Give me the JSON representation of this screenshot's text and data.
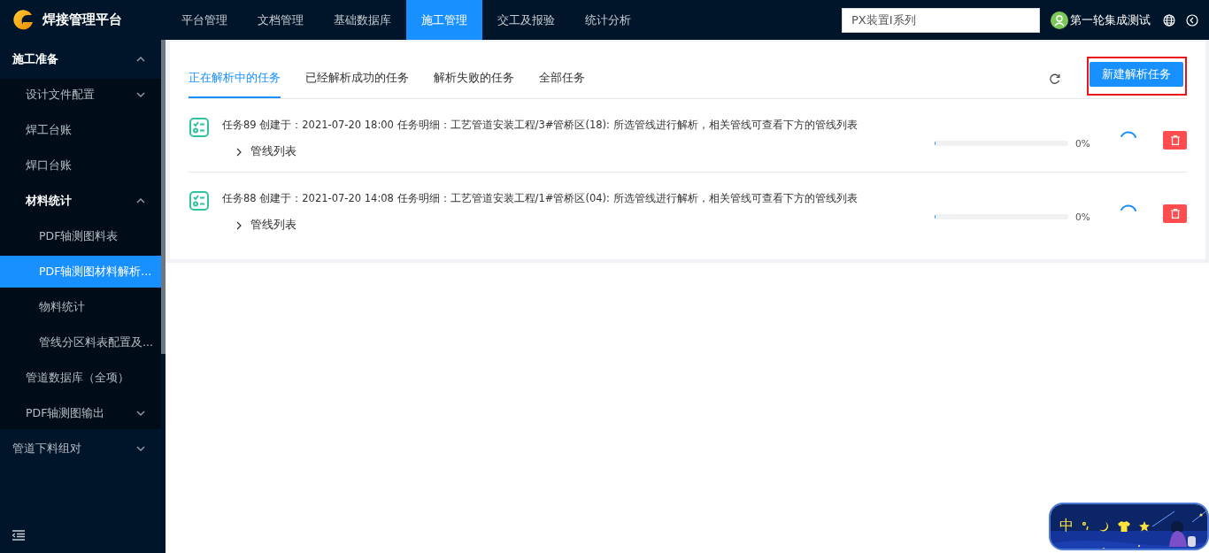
{
  "app": {
    "title": "焊接管理平台"
  },
  "nav": [
    {
      "label": "平台管理",
      "selected": false
    },
    {
      "label": "文档管理",
      "selected": false
    },
    {
      "label": "基础数据库",
      "selected": false
    },
    {
      "label": "施工管理",
      "selected": true
    },
    {
      "label": "交工及报验",
      "selected": false
    },
    {
      "label": "统计分析",
      "selected": false
    }
  ],
  "search": {
    "value": "PX装置I系列"
  },
  "user": {
    "name": "第一轮集成测试"
  },
  "sidebar": {
    "items": [
      {
        "label": "施工准备",
        "expanded": true,
        "selected": false,
        "children": [
          {
            "label": "设计文件配置",
            "expanded": false,
            "selected": false
          },
          {
            "label": "焊工台账",
            "selected": false
          },
          {
            "label": "焊口台账",
            "selected": false
          },
          {
            "label": "材料统计",
            "expanded": true,
            "selected": false,
            "children": [
              {
                "label": "PDF轴测图料表",
                "selected": false
              },
              {
                "label": "PDF轴测图材料解析...",
                "selected": true
              },
              {
                "label": "物料统计",
                "selected": false
              },
              {
                "label": "管线分区料表配置及...",
                "selected": false
              }
            ]
          },
          {
            "label": "管道数据库（全项）",
            "selected": false
          },
          {
            "label": "PDF轴测图输出",
            "expanded": false,
            "selected": false
          }
        ]
      },
      {
        "label": "管道下料组对",
        "expanded": false,
        "selected": false
      }
    ]
  },
  "tabs": [
    {
      "label": "正在解析中的任务",
      "selected": true
    },
    {
      "label": "已经解析成功的任务",
      "selected": false
    },
    {
      "label": "解析失败的任务",
      "selected": false
    },
    {
      "label": "全部任务",
      "selected": false
    }
  ],
  "new_button": {
    "label": "新建解析任务",
    "highlighted": true
  },
  "tasks": [
    {
      "title": "任务89 创建于：2021-07-20 18:00 任务明细：工艺管道安装工程/3#管桥区(18): 所选管线进行解析，相关管线可查看下方的管线列表",
      "expander": {
        "label": "管线列表",
        "expanded": false
      },
      "level": 0,
      "reading": "0%"
    },
    {
      "title": "任务88 创建于：2021-07-20 14:08 任务明细：工艺管道安装工程/1#管桥区(04): 所选管线进行解析，相关管线可查看下方的管线列表",
      "expander": {
        "label": "管线列表",
        "expanded": false
      },
      "level": 0,
      "reading": "0%"
    }
  ],
  "ime": {
    "mode": "中"
  }
}
